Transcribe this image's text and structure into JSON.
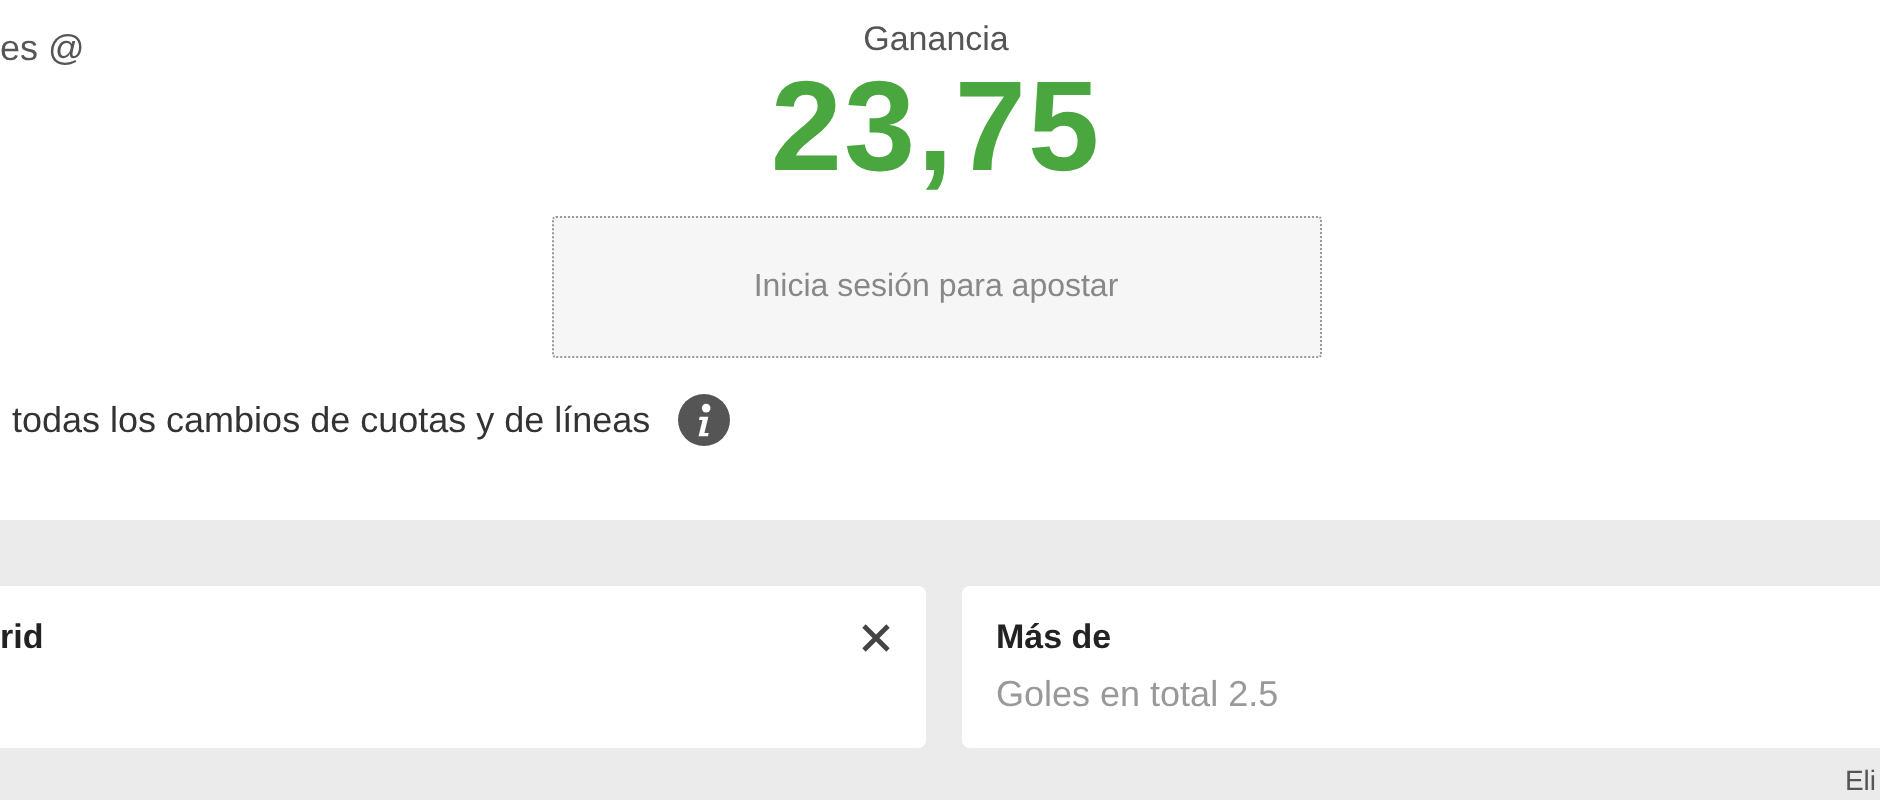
{
  "header_left": "es @",
  "profit": {
    "label": "Ganancia",
    "value": "23,75"
  },
  "login_button": "Inicia sesión para apostar",
  "odds_notice": "todas los cambios de cuotas y de líneas",
  "selections": [
    {
      "title": "rid",
      "removable": true
    },
    {
      "title": "Más de",
      "subtitle": "Goles en total 2.5",
      "removable": false
    }
  ],
  "footer_link": "Eli"
}
